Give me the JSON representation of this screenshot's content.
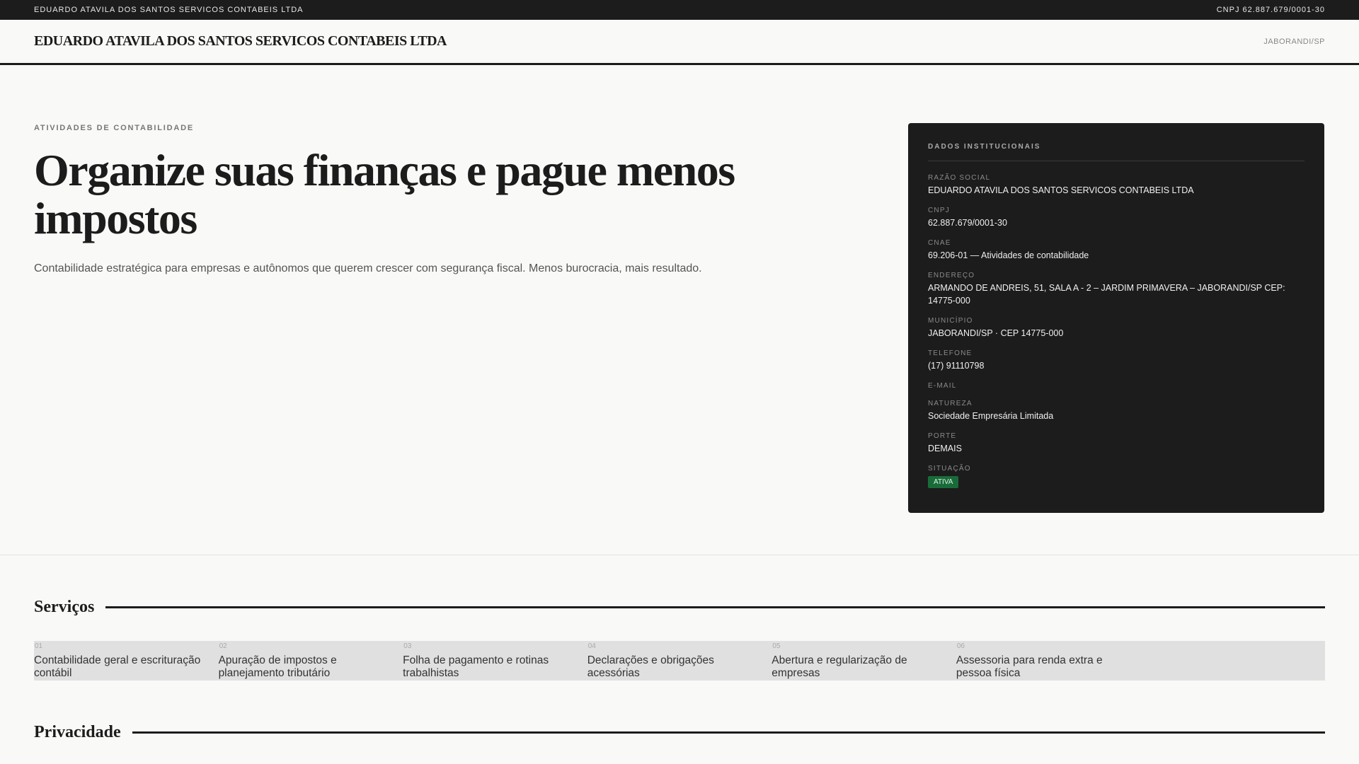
{
  "topbar": {
    "company": "EDUARDO ATAVILA DOS SANTOS SERVICOS CONTABEIS LTDA",
    "cnpj": "CNPJ 62.887.679/0001-30"
  },
  "header": {
    "brand": "EDUARDO ATAVILA DOS SANTOS SERVICOS CONTABEIS LTDA",
    "city": "JABORANDI/SP"
  },
  "hero": {
    "eyebrow": "ATIVIDADES DE CONTABILIDADE",
    "title": "Organize suas finanças e pague menos impostos",
    "subtitle": "Contabilidade estratégica para empresas e autônomos que querem crescer com segurança fiscal. Menos burocracia, mais resultado."
  },
  "panel": {
    "title": "DADOS INSTITUCIONAIS",
    "fields": [
      {
        "label": "RAZÃO SOCIAL",
        "value": "EDUARDO ATAVILA DOS SANTOS SERVICOS CONTABEIS LTDA"
      },
      {
        "label": "CNPJ",
        "value": "62.887.679/0001-30"
      },
      {
        "label": "CNAE",
        "value": "69.206-01 — Atividades de contabilidade"
      },
      {
        "label": "ENDEREÇO",
        "value": "ARMANDO DE ANDREIS, 51, SALA A - 2 – JARDIM PRIMAVERA – JABORANDI/SP CEP: 14775-000"
      },
      {
        "label": "MUNICÍPIO",
        "value": "JABORANDI/SP · CEP 14775-000"
      },
      {
        "label": "TELEFONE",
        "value": "(17) 91110798"
      },
      {
        "label": "E-MAIL",
        "value": ""
      },
      {
        "label": "NATUREZA",
        "value": "Sociedade Empresária Limitada"
      },
      {
        "label": "PORTE",
        "value": "DEMAIS"
      },
      {
        "label": "SITUAÇÃO",
        "value": "ATIVA"
      }
    ],
    "status_color": "#1a6b3a"
  },
  "services": {
    "title": "Serviços",
    "items": [
      {
        "num": "01",
        "name": "Contabilidade geral e escrituração contábil"
      },
      {
        "num": "02",
        "name": "Apuração de impostos e planejamento tributário"
      },
      {
        "num": "03",
        "name": "Folha de pagamento e rotinas trabalhistas"
      },
      {
        "num": "04",
        "name": "Declarações e obrigações acessórias"
      },
      {
        "num": "05",
        "name": "Abertura e regularização de empresas"
      },
      {
        "num": "06",
        "name": "Assessoria para renda extra e pessoa física"
      }
    ]
  },
  "privacy": {
    "title": "Privacidade"
  }
}
